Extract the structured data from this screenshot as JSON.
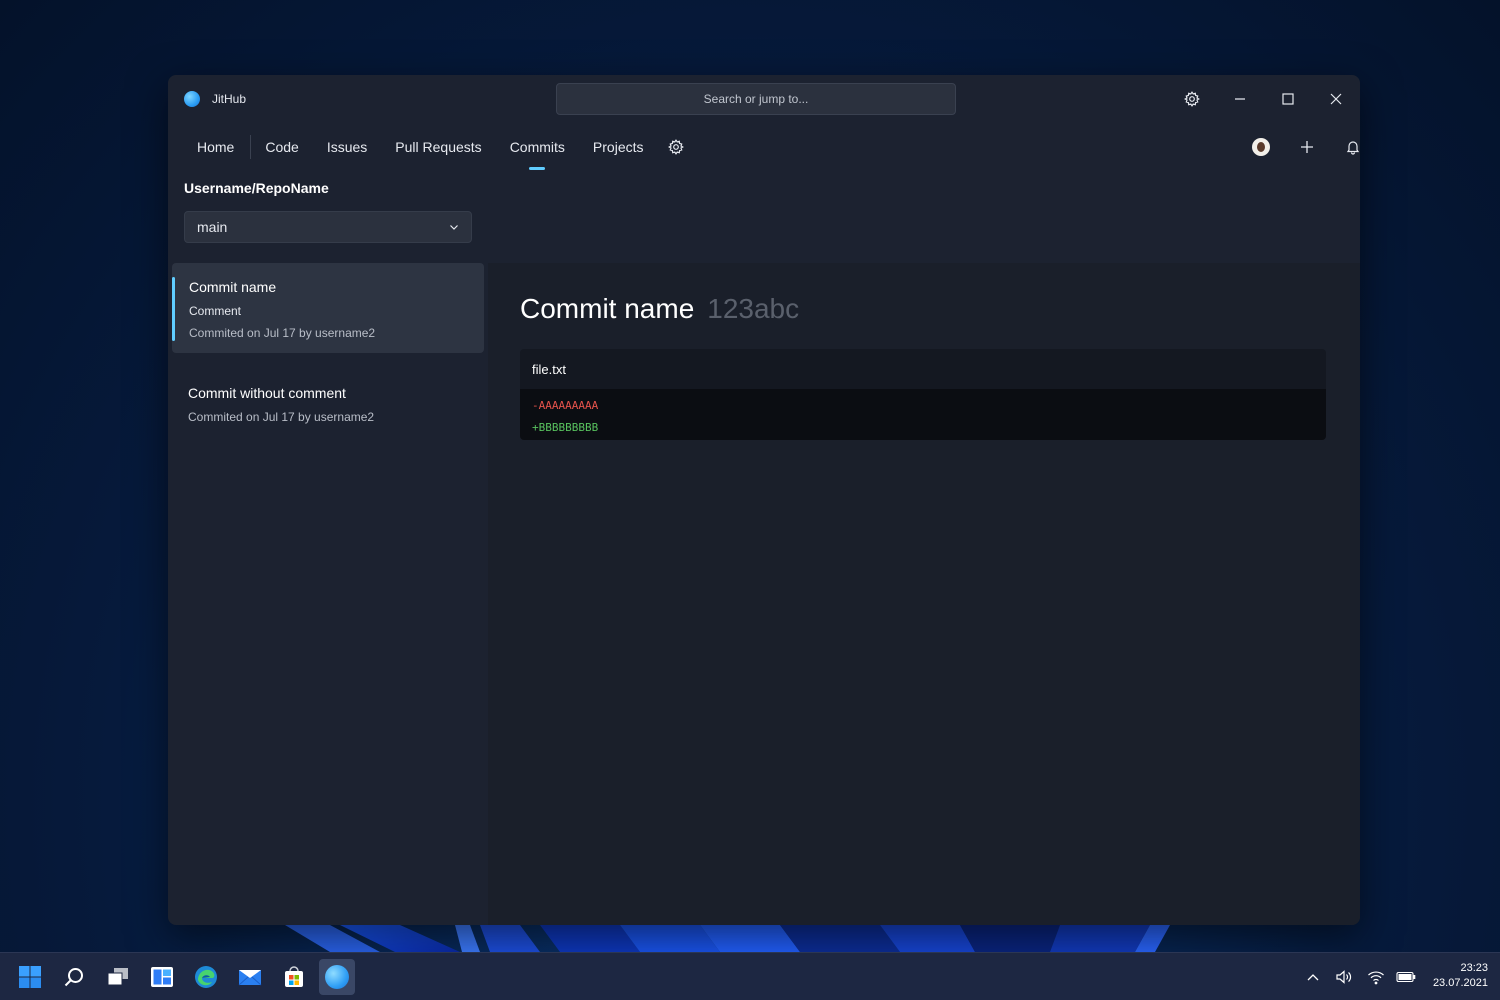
{
  "window": {
    "app_title": "JitHub",
    "search_placeholder": "Search or jump to..."
  },
  "nav": {
    "items": [
      {
        "label": "Home"
      },
      {
        "label": "Code"
      },
      {
        "label": "Issues"
      },
      {
        "label": "Pull Requests"
      },
      {
        "label": "Commits",
        "active": true
      },
      {
        "label": "Projects"
      }
    ]
  },
  "repo": {
    "name": "Username/RepoName",
    "branch": "main"
  },
  "commits": [
    {
      "title": "Commit name",
      "comment": "Comment",
      "meta": "Commited on Jul 17 by username2",
      "selected": true
    },
    {
      "title": "Commit without comment",
      "meta": "Commited on Jul 17 by username2",
      "selected": false
    }
  ],
  "detail": {
    "title": "Commit name",
    "hash": "123abc",
    "files": [
      {
        "name": "file.txt",
        "lines": [
          {
            "type": "del",
            "text": "-AAAAAAAAA"
          },
          {
            "type": "add",
            "text": "+BBBBBBBBB"
          }
        ]
      }
    ]
  },
  "taskbar": {
    "apps": [
      "start-icon",
      "search-icon",
      "task-view-icon",
      "widgets-icon",
      "edge-icon",
      "mail-icon",
      "store-icon",
      "jithub-icon"
    ],
    "time": "23:23",
    "date": "23.07.2021"
  },
  "colors": {
    "accent": "#60cdff",
    "diff_del": "#e5524b",
    "diff_add": "#58c25e"
  }
}
